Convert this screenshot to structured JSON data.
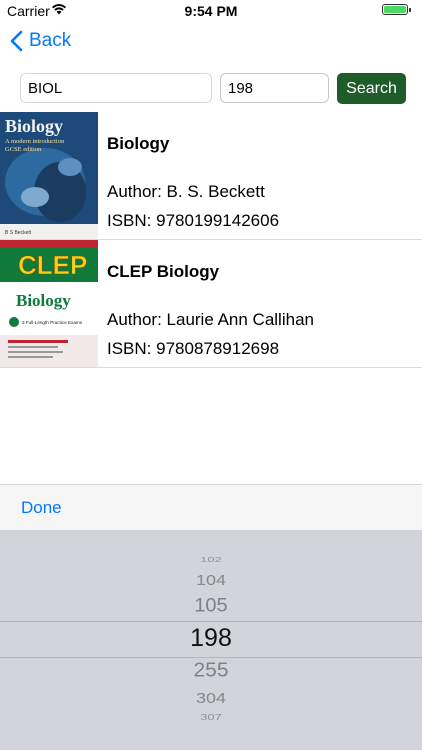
{
  "status": {
    "carrier": "Carrier",
    "time": "9:54 PM"
  },
  "nav": {
    "back_label": "Back"
  },
  "search": {
    "department_value": "BIOL",
    "number_value": "198",
    "button_label": "Search"
  },
  "results": [
    {
      "title": "Biology",
      "author": "Author: B. S. Beckett",
      "isbn": "ISBN: 9780199142606",
      "cover": {
        "title_text": "Biology",
        "subtitle_text": "A modern introduction",
        "edition_text": "GCSE edition",
        "author_text": "B S Beckett",
        "color": "#1d4a78"
      }
    },
    {
      "title": "CLEP Biology",
      "author": "Author: Laurie Ann Callihan",
      "isbn": "ISBN: 9780878912698",
      "cover": {
        "brand_text": "CLEP",
        "title_text": "Biology",
        "promo_text": "3 Full-Length Practice Exams",
        "color": "#0f7a3a"
      }
    }
  ],
  "toolbar": {
    "done_label": "Done"
  },
  "picker": {
    "options": [
      "102",
      "104",
      "105",
      "198",
      "255",
      "304",
      "307"
    ],
    "selected": "198"
  },
  "colors": {
    "accent": "#007aff",
    "search_button": "#1f5c2a",
    "picker_bg": "#d1d5db"
  }
}
